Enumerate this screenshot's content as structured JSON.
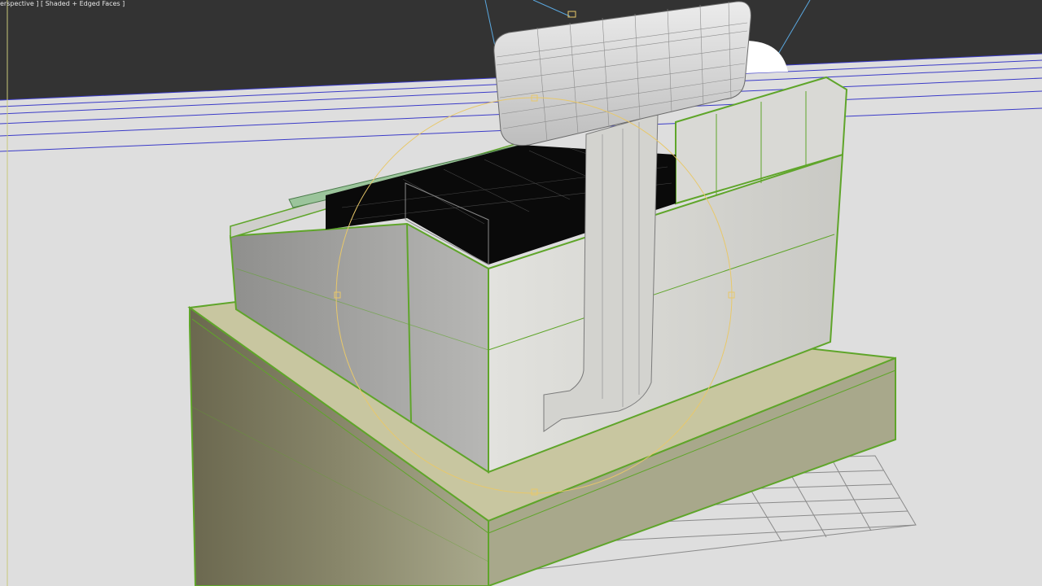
{
  "viewport": {
    "label": "erspective ] [ Shaded + Edged Faces ]",
    "background_top": "#333333",
    "floor_color": "#dedede"
  },
  "scene": {
    "selection_color": "#5fa52a",
    "gizmo_color": "#e8c86a",
    "light_line_color": "#5aa8e0",
    "horizon_line_color": "#3b3bc8"
  }
}
